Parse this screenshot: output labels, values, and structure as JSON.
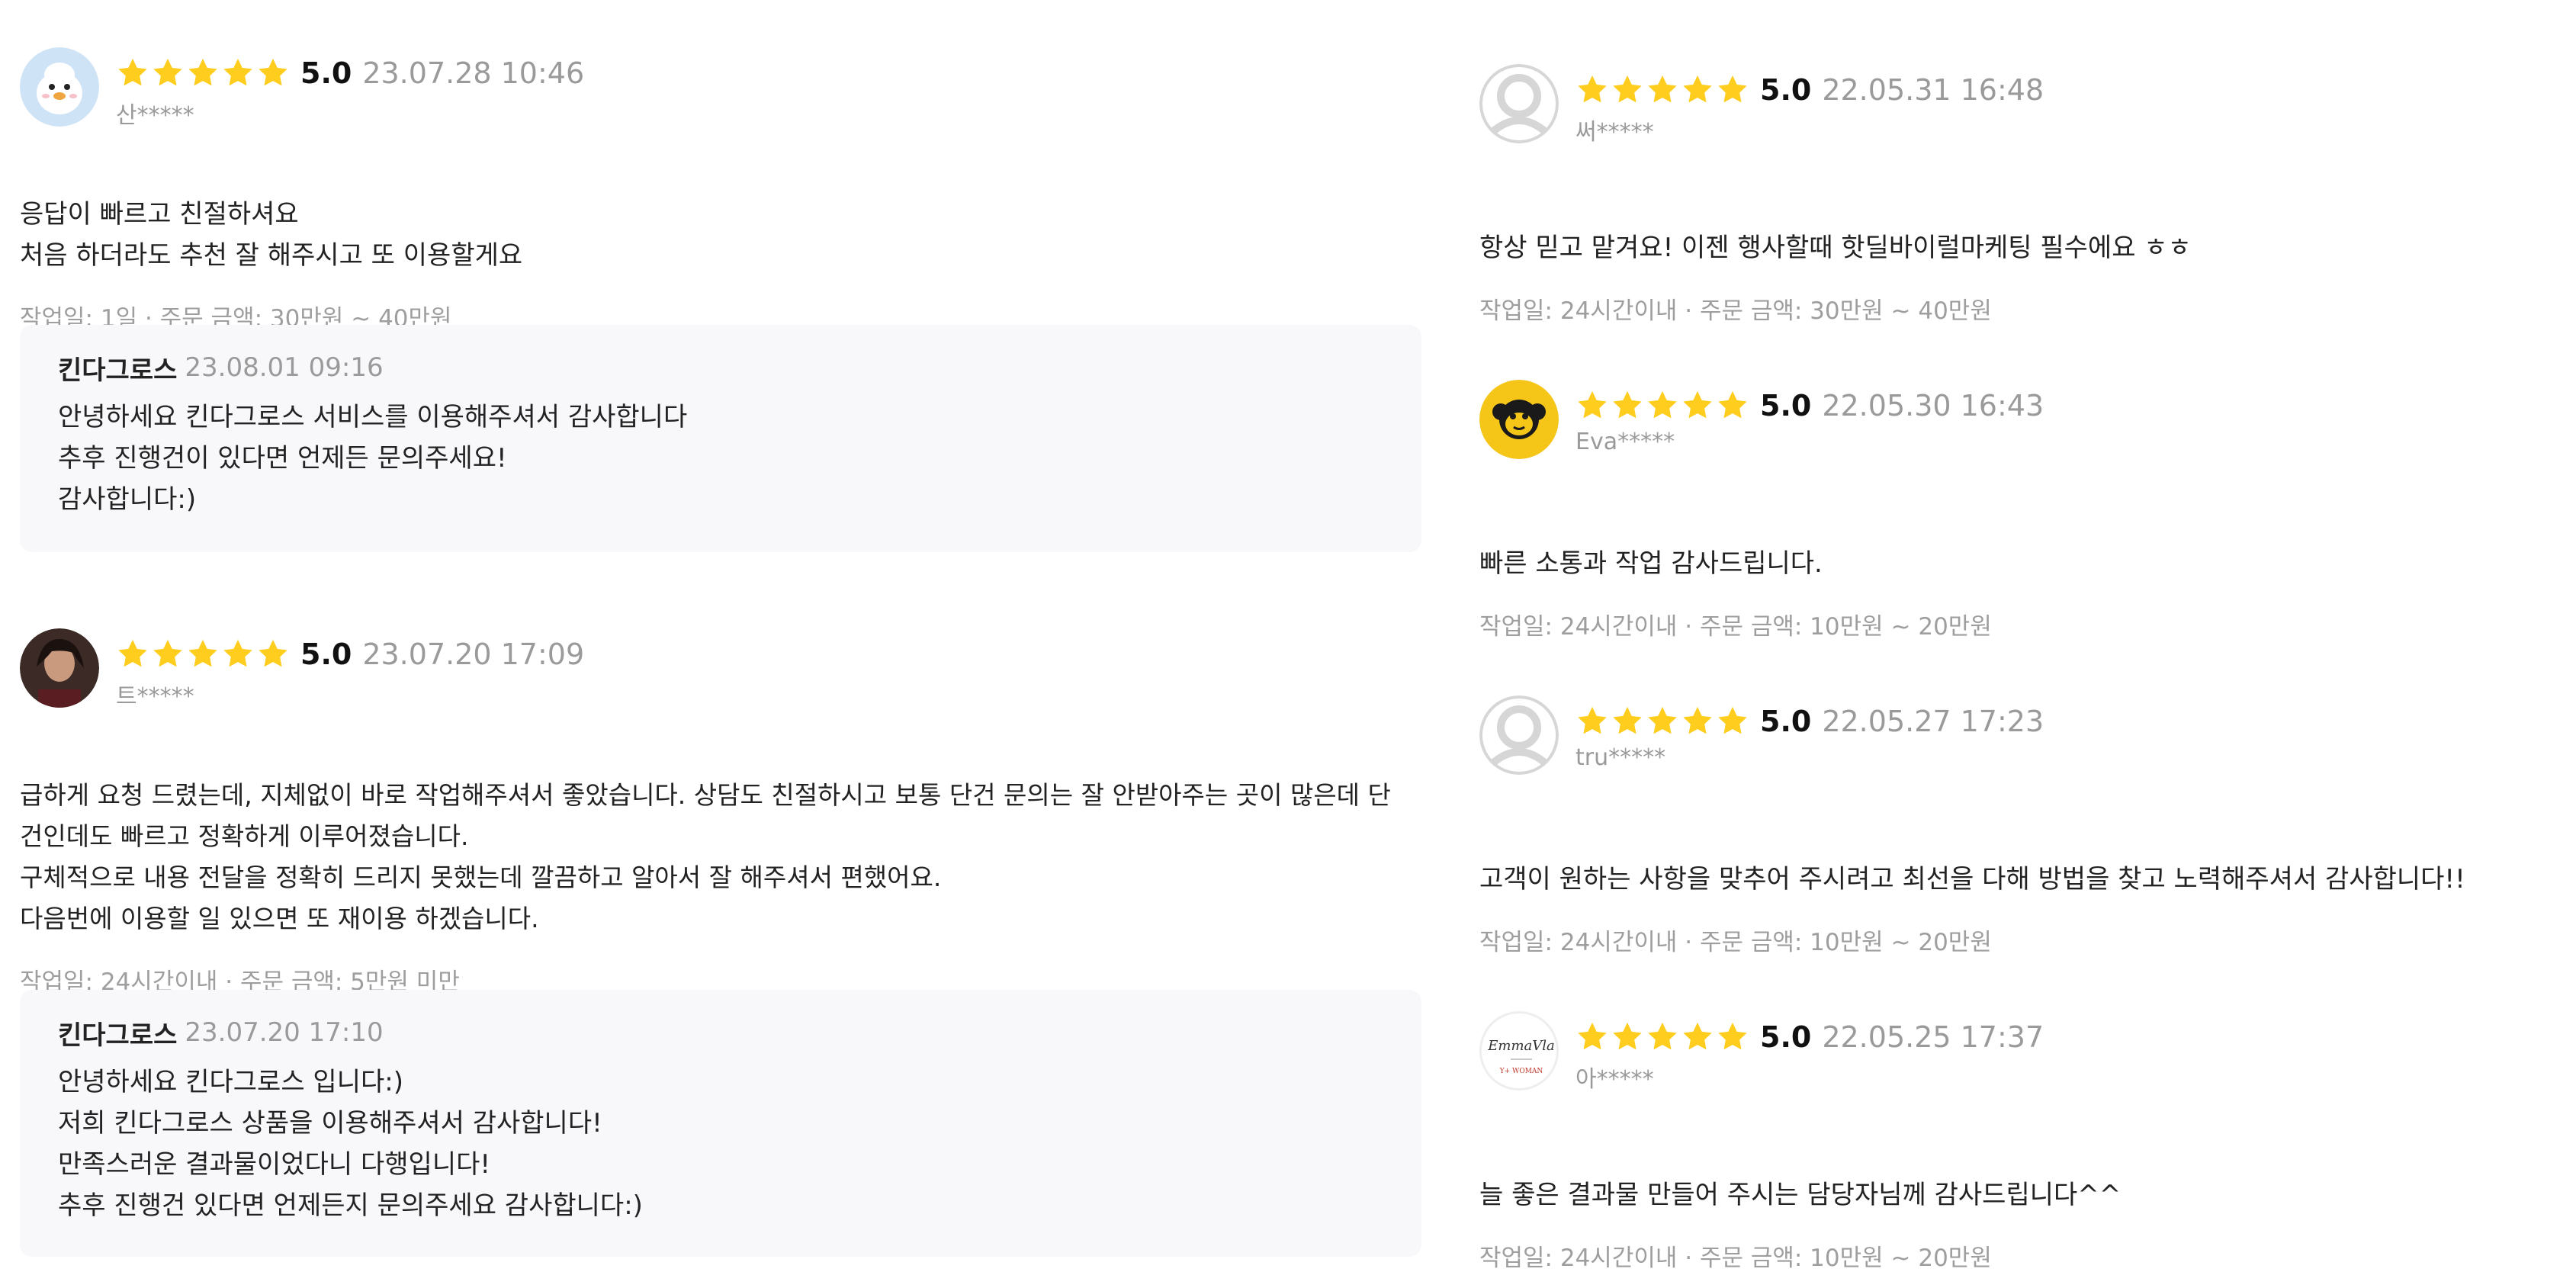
{
  "colors": {
    "star": "#ffcd1e",
    "muted": "#9a9a9a",
    "reply_bg": "#f8f8fa"
  },
  "left_reviews": [
    {
      "avatar": "bird-avatar-icon",
      "score": "5.0",
      "date": "23.07.28 10:46",
      "user": "산*****",
      "lines": [
        "응답이 빠르고 친절하셔요",
        "처음 하더라도 추천 잘 해주시고 또 이용할게요"
      ],
      "info": "작업일: 1일 · 주문 금액: 30만원 ~ 40만원",
      "reply": {
        "author": "킨다그로스",
        "date": "23.08.01 09:16",
        "lines": [
          "안녕하세요 킨다그로스 서비스를 이용해주셔서 감사합니다",
          "추후 진행건이 있다면 언제든 문의주세요!",
          "감사합니다:)"
        ]
      }
    },
    {
      "avatar": "person-photo-avatar-icon",
      "score": "5.0",
      "date": "23.07.20 17:09",
      "user": "트*****",
      "lines": [
        "급하게 요청 드렸는데, 지체없이 바로 작업해주셔서 좋았습니다. 상담도 친절하시고 보통 단건 문의는 잘 안받아주는 곳이 많은데 단",
        "건인데도 빠르고 정확하게 이루어졌습니다.",
        "구체적으로 내용 전달을 정확히 드리지 못했는데 깔끔하고 알아서 잘 해주셔서 편했어요.",
        "다음번에 이용할 일 있으면 또 재이용 하겠습니다."
      ],
      "info": "작업일: 24시간이내 · 주문 금액: 5만원 미만",
      "reply": {
        "author": "킨다그로스",
        "date": "23.07.20 17:10",
        "lines": [
          "안녕하세요 킨다그로스 입니다:)",
          "저희 킨다그로스 상품을 이용해주셔서 감사합니다!",
          "만족스러운 결과물이었다니 다행입니다!",
          "추후 진행건 있다면 언제든지 문의주세요 감사합니다:)"
        ]
      }
    }
  ],
  "right_reviews": [
    {
      "avatar": "default-user-avatar-icon",
      "score": "5.0",
      "date": "22.05.31 16:48",
      "user": "써*****",
      "lines": [
        "항상 믿고 맡겨요! 이젠 행사할때 핫딜바이럴마케팅 필수에요 ㅎㅎ"
      ],
      "info": "작업일: 24시간이내 · 주문 금액: 30만원 ~ 40만원"
    },
    {
      "avatar": "monkey-avatar-icon",
      "score": "5.0",
      "date": "22.05.30 16:43",
      "user": "Eva*****",
      "lines": [
        "빠른 소통과 작업 감사드립니다."
      ],
      "info": "작업일: 24시간이내 · 주문 금액: 10만원 ~ 20만원"
    },
    {
      "avatar": "default-user-avatar-icon",
      "score": "5.0",
      "date": "22.05.27 17:23",
      "user": "tru*****",
      "lines": [
        "고객이 원하는 사항을 맞추어 주시려고 최선을 다해 방법을 찾고 노력해주셔서 감사합니다!!"
      ],
      "info": "작업일: 24시간이내 · 주문 금액: 10만원 ~ 20만원"
    },
    {
      "avatar": "emmavla-logo-avatar-icon",
      "avatar_text": "EmmaVla",
      "avatar_subtext": "Y+ WOMAN",
      "score": "5.0",
      "date": "22.05.25 17:37",
      "user": "아*****",
      "lines": [
        "늘 좋은 결과물 만들어 주시는 담당자님께 감사드립니다^^"
      ],
      "info": "작업일: 24시간이내 · 주문 금액: 10만원 ~ 20만원"
    }
  ]
}
